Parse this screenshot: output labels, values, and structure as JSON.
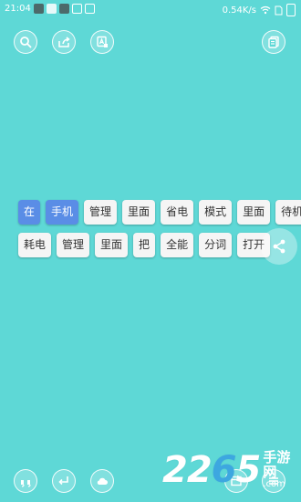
{
  "status_bar": {
    "time": "21:04",
    "network_speed": "0.54K/s"
  },
  "toolbar_top": {
    "search_icon": "search-icon",
    "share_out_icon": "share-out-icon",
    "translate_icon": "translate-icon",
    "copy_icon": "copy-icon"
  },
  "chips": {
    "row1": [
      "在",
      "手机",
      "管理",
      "里面",
      "省电",
      "模式",
      "里面",
      "待机"
    ],
    "row2": [
      "耗电",
      "管理",
      "里面",
      "把",
      "全能",
      "分词",
      "打开"
    ],
    "selected_indices_row1": [
      0,
      1
    ]
  },
  "fab": {
    "icon": "share-icon"
  },
  "toolbar_bottom": {
    "icons": [
      "quote-icon",
      "return-icon",
      "cloud-icon",
      "window-icon",
      "list-icon"
    ]
  },
  "watermark": {
    "number_a": "22",
    "number_b": "6",
    "number_c": "5",
    "cn_text": "手游网",
    "en_text": ".com"
  },
  "colors": {
    "background": "#5ed8d6",
    "chip_selected": "#5a8de6",
    "chip_default": "#f5f5f5"
  }
}
